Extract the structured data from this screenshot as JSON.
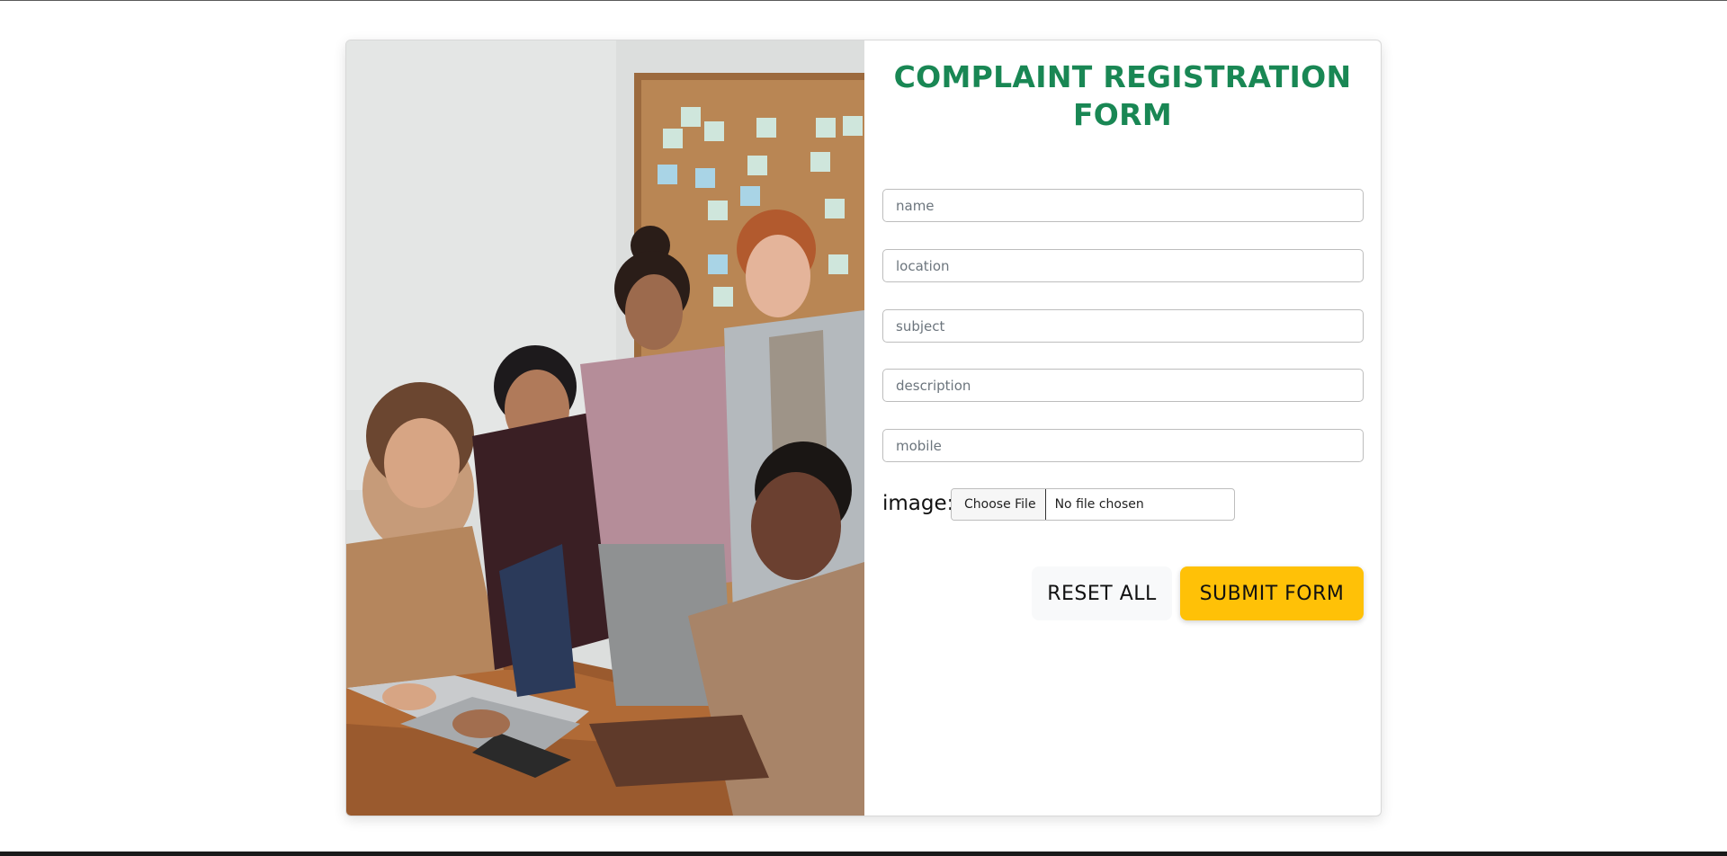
{
  "form": {
    "title": "COMPLAINT REGISTRATION FORM",
    "fields": [
      {
        "name": "name",
        "placeholder": "name"
      },
      {
        "name": "location",
        "placeholder": "location"
      },
      {
        "name": "subject",
        "placeholder": "subject"
      },
      {
        "name": "description",
        "placeholder": "description"
      },
      {
        "name": "mobile",
        "placeholder": "mobile"
      }
    ],
    "image_label": "image:",
    "file_button": "Choose File",
    "file_status": "No file chosen",
    "reset_label": "RESET ALL",
    "submit_label": "SUBMIT FORM"
  },
  "colors": {
    "title": "#198754",
    "submit_bg": "#ffc107",
    "reset_bg": "#f8f9fa"
  }
}
